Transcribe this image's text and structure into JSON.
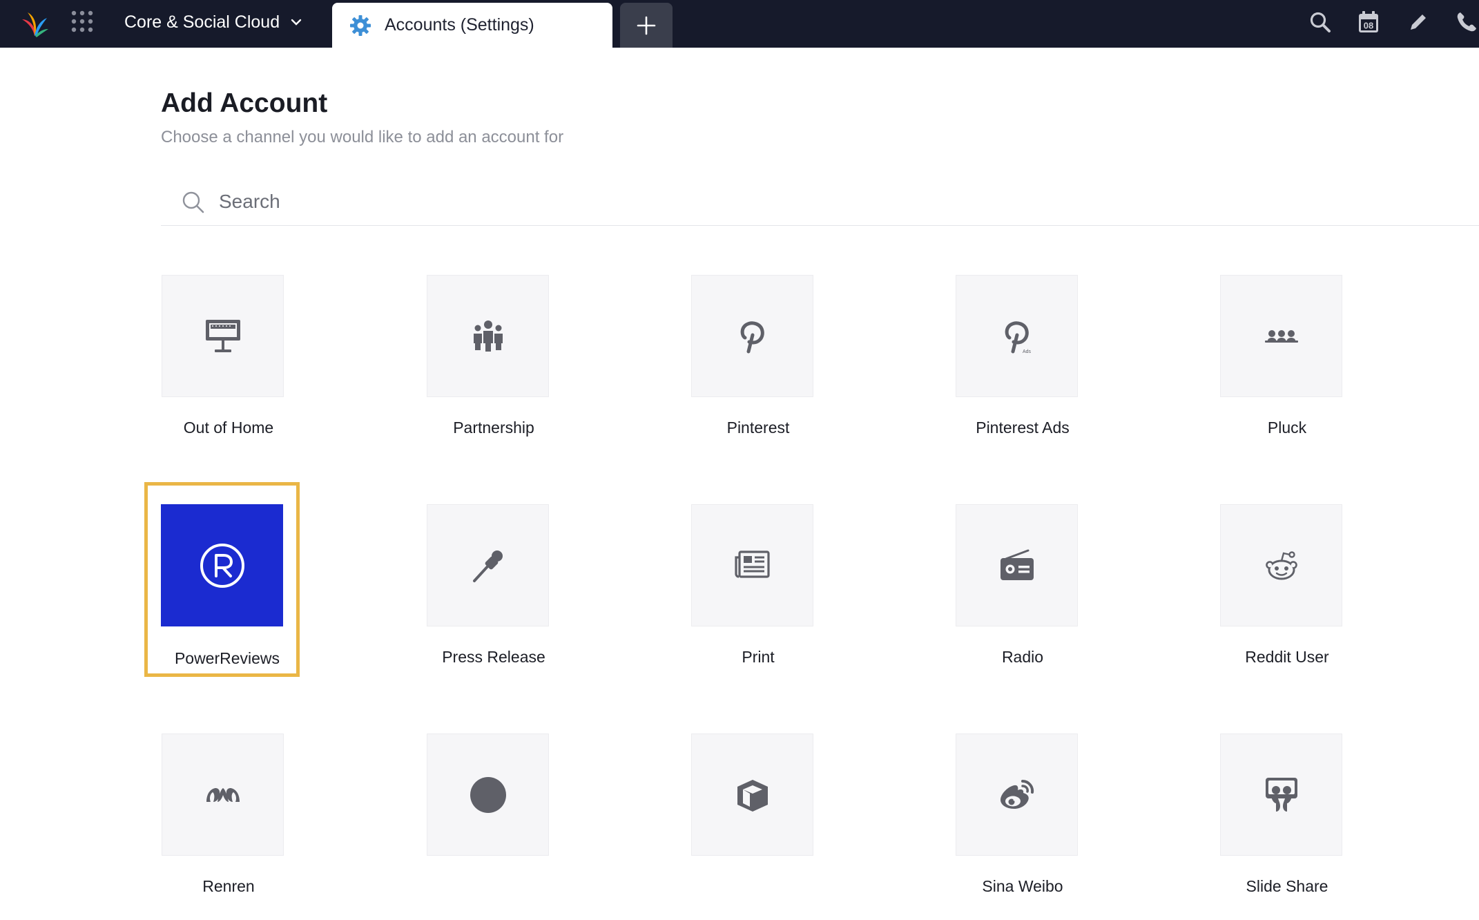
{
  "topbar": {
    "workspace": "Core & Social Cloud",
    "active_tab": "Accounts (Settings)",
    "calendar_day": "08"
  },
  "header": {
    "title": "Add Account",
    "subtitle": "Choose a channel you would like to add an account for"
  },
  "search": {
    "placeholder": "Search",
    "value": ""
  },
  "channels": [
    {
      "label": "Out of Home",
      "icon": "billboard-icon"
    },
    {
      "label": "Partnership",
      "icon": "people-group-icon"
    },
    {
      "label": "Pinterest",
      "icon": "pinterest-icon"
    },
    {
      "label": "Pinterest Ads",
      "icon": "pinterest-ads-icon",
      "icon_text": "Ads"
    },
    {
      "label": "Pluck",
      "icon": "community-icon"
    },
    {
      "label": "PowerReviews",
      "icon": "registered-r-icon",
      "selected": true
    },
    {
      "label": "Press Release",
      "icon": "microphone-icon"
    },
    {
      "label": "Print",
      "icon": "newspaper-icon"
    },
    {
      "label": "Radio",
      "icon": "radio-icon"
    },
    {
      "label": "Reddit User",
      "icon": "reddit-icon"
    },
    {
      "label": "Renren",
      "icon": "renren-icon"
    },
    {
      "label": "",
      "icon": "circle-icon"
    },
    {
      "label": "",
      "icon": "box-icon"
    },
    {
      "label": "Sina Weibo",
      "icon": "weibo-icon"
    },
    {
      "label": "Slide Share",
      "icon": "slideshare-icon"
    }
  ],
  "colors": {
    "topbar": "#161a2b",
    "selected_tile": "#1b2bd0",
    "selection_border": "#eab646",
    "icon_gray": "#5f6068"
  }
}
